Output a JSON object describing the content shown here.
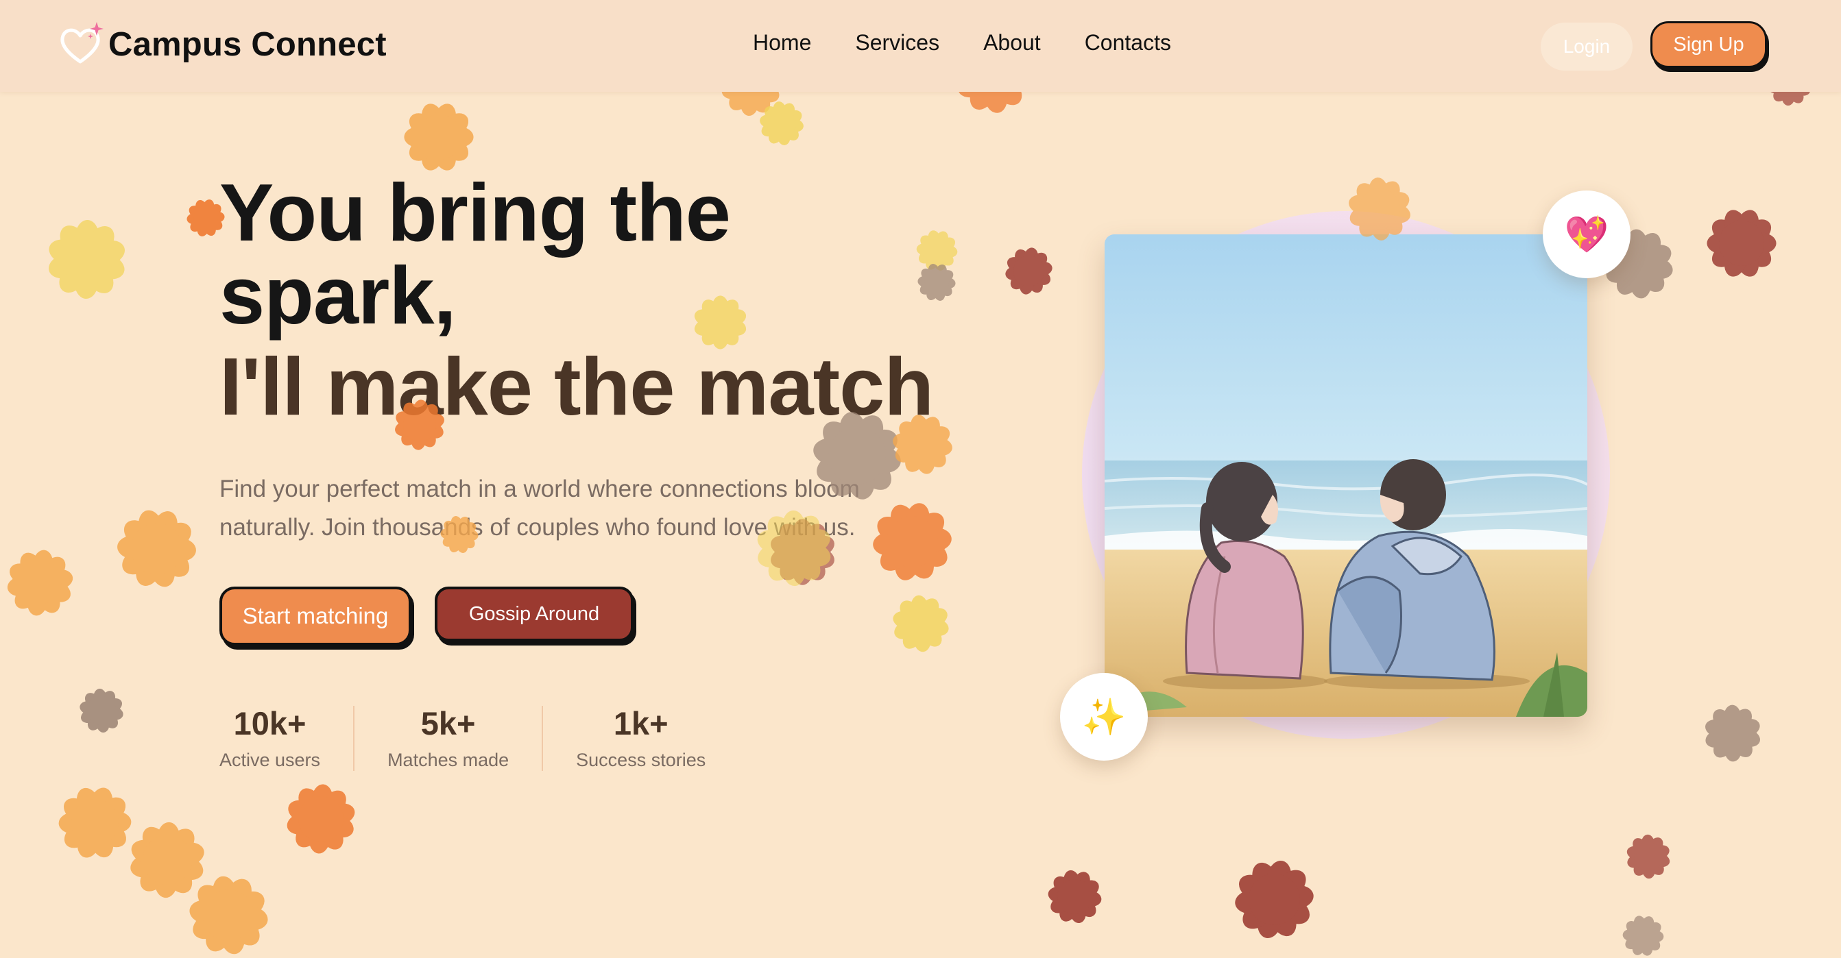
{
  "header": {
    "brand": "Campus Connect",
    "logo_icon": "heart-sparkle-icon",
    "nav": [
      "Home",
      "Services",
      "About",
      "Contacts"
    ],
    "login_label": "Login",
    "signup_label": "Sign Up"
  },
  "hero": {
    "headline_line1": "You bring the spark,",
    "headline_line2": "I'll make the match",
    "subtitle": "Find your perfect match in a world where connections bloom naturally. Join thousands of couples who found love with us.",
    "primary_cta": "Start matching",
    "secondary_cta": "Gossip Around",
    "stats": [
      {
        "value": "10k+",
        "label": "Active users"
      },
      {
        "value": "5k+",
        "label": "Matches made"
      },
      {
        "value": "1k+",
        "label": "Success stories"
      }
    ]
  },
  "illustration": {
    "top_badge_icon": "sparkling-heart-icon",
    "top_badge_glyph": "💖",
    "bottom_badge_icon": "sparkles-icon",
    "bottom_badge_glyph": "✨"
  },
  "colors": {
    "background": "#fbe6cb",
    "header": "#f8dfc8",
    "accent_orange": "#ef8c4e",
    "accent_maroon": "#9b3a30",
    "heading_dark": "#161616",
    "heading_brown": "#4a3526",
    "muted_text": "#7a6b62",
    "flower_colors": [
      "#f5a84e",
      "#f2d45a",
      "#9e3f35",
      "#a08878",
      "#ef7a30"
    ]
  }
}
